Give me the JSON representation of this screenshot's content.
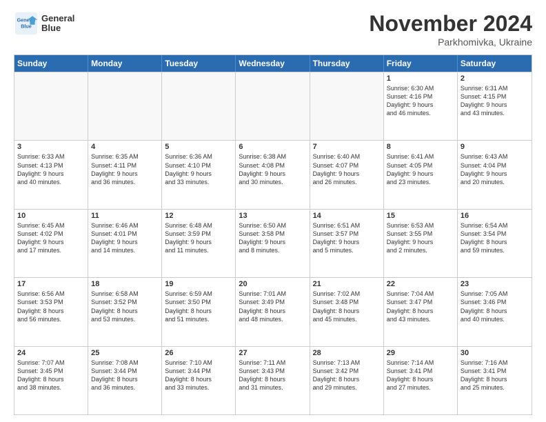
{
  "logo": {
    "line1": "General",
    "line2": "Blue"
  },
  "title": "November 2024",
  "location": "Parkhomivka, Ukraine",
  "days_of_week": [
    "Sunday",
    "Monday",
    "Tuesday",
    "Wednesday",
    "Thursday",
    "Friday",
    "Saturday"
  ],
  "weeks": [
    [
      {
        "day": "",
        "info": "",
        "empty": true
      },
      {
        "day": "",
        "info": "",
        "empty": true
      },
      {
        "day": "",
        "info": "",
        "empty": true
      },
      {
        "day": "",
        "info": "",
        "empty": true
      },
      {
        "day": "",
        "info": "",
        "empty": true
      },
      {
        "day": "1",
        "info": "Sunrise: 6:30 AM\nSunset: 4:16 PM\nDaylight: 9 hours\nand 46 minutes.",
        "empty": false
      },
      {
        "day": "2",
        "info": "Sunrise: 6:31 AM\nSunset: 4:15 PM\nDaylight: 9 hours\nand 43 minutes.",
        "empty": false
      }
    ],
    [
      {
        "day": "3",
        "info": "Sunrise: 6:33 AM\nSunset: 4:13 PM\nDaylight: 9 hours\nand 40 minutes.",
        "empty": false
      },
      {
        "day": "4",
        "info": "Sunrise: 6:35 AM\nSunset: 4:11 PM\nDaylight: 9 hours\nand 36 minutes.",
        "empty": false
      },
      {
        "day": "5",
        "info": "Sunrise: 6:36 AM\nSunset: 4:10 PM\nDaylight: 9 hours\nand 33 minutes.",
        "empty": false
      },
      {
        "day": "6",
        "info": "Sunrise: 6:38 AM\nSunset: 4:08 PM\nDaylight: 9 hours\nand 30 minutes.",
        "empty": false
      },
      {
        "day": "7",
        "info": "Sunrise: 6:40 AM\nSunset: 4:07 PM\nDaylight: 9 hours\nand 26 minutes.",
        "empty": false
      },
      {
        "day": "8",
        "info": "Sunrise: 6:41 AM\nSunset: 4:05 PM\nDaylight: 9 hours\nand 23 minutes.",
        "empty": false
      },
      {
        "day": "9",
        "info": "Sunrise: 6:43 AM\nSunset: 4:04 PM\nDaylight: 9 hours\nand 20 minutes.",
        "empty": false
      }
    ],
    [
      {
        "day": "10",
        "info": "Sunrise: 6:45 AM\nSunset: 4:02 PM\nDaylight: 9 hours\nand 17 minutes.",
        "empty": false
      },
      {
        "day": "11",
        "info": "Sunrise: 6:46 AM\nSunset: 4:01 PM\nDaylight: 9 hours\nand 14 minutes.",
        "empty": false
      },
      {
        "day": "12",
        "info": "Sunrise: 6:48 AM\nSunset: 3:59 PM\nDaylight: 9 hours\nand 11 minutes.",
        "empty": false
      },
      {
        "day": "13",
        "info": "Sunrise: 6:50 AM\nSunset: 3:58 PM\nDaylight: 9 hours\nand 8 minutes.",
        "empty": false
      },
      {
        "day": "14",
        "info": "Sunrise: 6:51 AM\nSunset: 3:57 PM\nDaylight: 9 hours\nand 5 minutes.",
        "empty": false
      },
      {
        "day": "15",
        "info": "Sunrise: 6:53 AM\nSunset: 3:55 PM\nDaylight: 9 hours\nand 2 minutes.",
        "empty": false
      },
      {
        "day": "16",
        "info": "Sunrise: 6:54 AM\nSunset: 3:54 PM\nDaylight: 8 hours\nand 59 minutes.",
        "empty": false
      }
    ],
    [
      {
        "day": "17",
        "info": "Sunrise: 6:56 AM\nSunset: 3:53 PM\nDaylight: 8 hours\nand 56 minutes.",
        "empty": false
      },
      {
        "day": "18",
        "info": "Sunrise: 6:58 AM\nSunset: 3:52 PM\nDaylight: 8 hours\nand 53 minutes.",
        "empty": false
      },
      {
        "day": "19",
        "info": "Sunrise: 6:59 AM\nSunset: 3:50 PM\nDaylight: 8 hours\nand 51 minutes.",
        "empty": false
      },
      {
        "day": "20",
        "info": "Sunrise: 7:01 AM\nSunset: 3:49 PM\nDaylight: 8 hours\nand 48 minutes.",
        "empty": false
      },
      {
        "day": "21",
        "info": "Sunrise: 7:02 AM\nSunset: 3:48 PM\nDaylight: 8 hours\nand 45 minutes.",
        "empty": false
      },
      {
        "day": "22",
        "info": "Sunrise: 7:04 AM\nSunset: 3:47 PM\nDaylight: 8 hours\nand 43 minutes.",
        "empty": false
      },
      {
        "day": "23",
        "info": "Sunrise: 7:05 AM\nSunset: 3:46 PM\nDaylight: 8 hours\nand 40 minutes.",
        "empty": false
      }
    ],
    [
      {
        "day": "24",
        "info": "Sunrise: 7:07 AM\nSunset: 3:45 PM\nDaylight: 8 hours\nand 38 minutes.",
        "empty": false
      },
      {
        "day": "25",
        "info": "Sunrise: 7:08 AM\nSunset: 3:44 PM\nDaylight: 8 hours\nand 36 minutes.",
        "empty": false
      },
      {
        "day": "26",
        "info": "Sunrise: 7:10 AM\nSunset: 3:44 PM\nDaylight: 8 hours\nand 33 minutes.",
        "empty": false
      },
      {
        "day": "27",
        "info": "Sunrise: 7:11 AM\nSunset: 3:43 PM\nDaylight: 8 hours\nand 31 minutes.",
        "empty": false
      },
      {
        "day": "28",
        "info": "Sunrise: 7:13 AM\nSunset: 3:42 PM\nDaylight: 8 hours\nand 29 minutes.",
        "empty": false
      },
      {
        "day": "29",
        "info": "Sunrise: 7:14 AM\nSunset: 3:41 PM\nDaylight: 8 hours\nand 27 minutes.",
        "empty": false
      },
      {
        "day": "30",
        "info": "Sunrise: 7:16 AM\nSunset: 3:41 PM\nDaylight: 8 hours\nand 25 minutes.",
        "empty": false
      }
    ]
  ]
}
